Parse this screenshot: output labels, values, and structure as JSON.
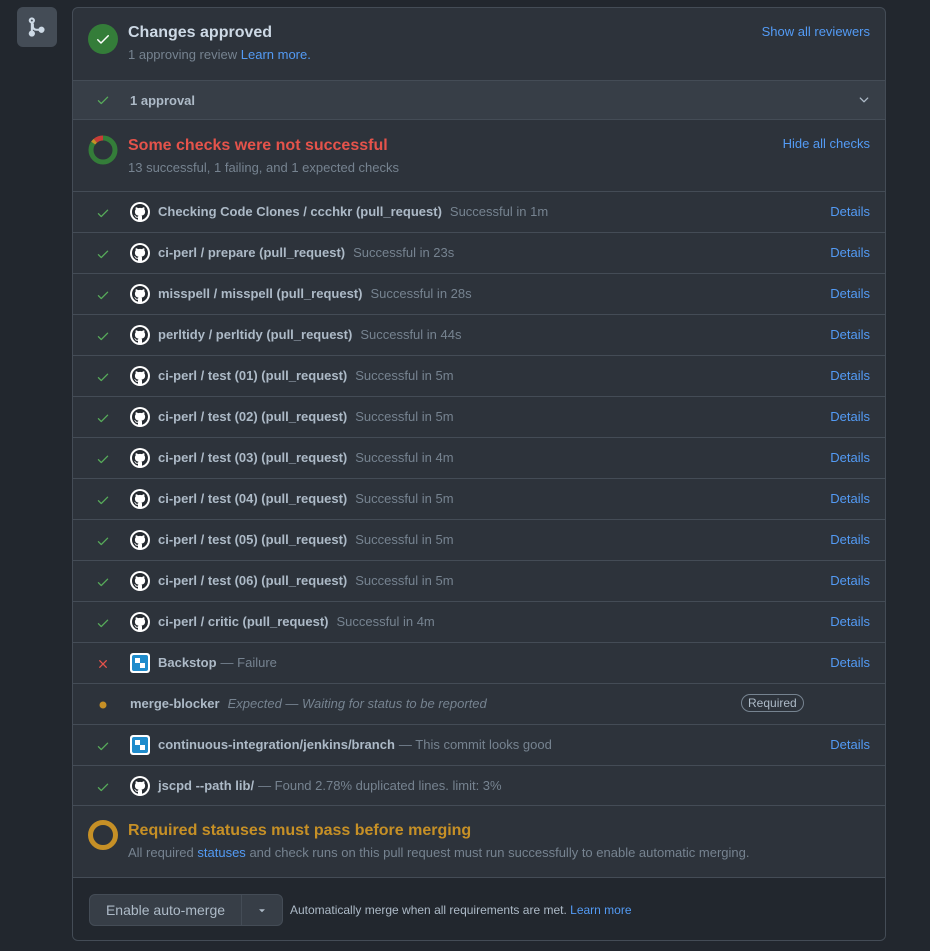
{
  "colors": {
    "green": "#57ab5a",
    "red": "#e5534b",
    "yellow": "#c69026",
    "link": "#539bf5"
  },
  "review": {
    "title": "Changes approved",
    "subtitle": "1 approving review",
    "learn_more": "Learn more.",
    "show_all": "Show all reviewers",
    "approval_row": "1 approval"
  },
  "checks_header": {
    "title": "Some checks were not successful",
    "subtitle": "13 successful, 1 failing, and 1 expected checks",
    "hide_all": "Hide all checks"
  },
  "checks": [
    {
      "status": "success",
      "avatar": "github",
      "name": "Checking Code Clones / ccchkr (pull_request)",
      "desc": "Successful in 1m",
      "details": "Details"
    },
    {
      "status": "success",
      "avatar": "github",
      "name": "ci-perl / prepare (pull_request)",
      "desc": "Successful in 23s",
      "details": "Details"
    },
    {
      "status": "success",
      "avatar": "github",
      "name": "misspell / misspell (pull_request)",
      "desc": "Successful in 28s",
      "details": "Details"
    },
    {
      "status": "success",
      "avatar": "github",
      "name": "perltidy / perltidy (pull_request)",
      "desc": "Successful in 44s",
      "details": "Details"
    },
    {
      "status": "success",
      "avatar": "github",
      "name": "ci-perl / test (01) (pull_request)",
      "desc": "Successful in 5m",
      "details": "Details"
    },
    {
      "status": "success",
      "avatar": "github",
      "name": "ci-perl / test (02) (pull_request)",
      "desc": "Successful in 5m",
      "details": "Details"
    },
    {
      "status": "success",
      "avatar": "github",
      "name": "ci-perl / test (03) (pull_request)",
      "desc": "Successful in 4m",
      "details": "Details"
    },
    {
      "status": "success",
      "avatar": "github",
      "name": "ci-perl / test (04) (pull_request)",
      "desc": "Successful in 5m",
      "details": "Details"
    },
    {
      "status": "success",
      "avatar": "github",
      "name": "ci-perl / test (05) (pull_request)",
      "desc": "Successful in 5m",
      "details": "Details"
    },
    {
      "status": "success",
      "avatar": "github",
      "name": "ci-perl / test (06) (pull_request)",
      "desc": "Successful in 5m",
      "details": "Details"
    },
    {
      "status": "success",
      "avatar": "github",
      "name": "ci-perl / critic (pull_request)",
      "desc": "Successful in 4m",
      "details": "Details"
    },
    {
      "status": "failure",
      "avatar": "jenkins",
      "name": "Backstop",
      "desc": "— Failure",
      "details": "Details"
    },
    {
      "status": "pending",
      "avatar": "none",
      "name": "merge-blocker",
      "desc": "Expected — Waiting for status to be reported",
      "badge": "Required"
    },
    {
      "status": "success",
      "avatar": "jenkins",
      "name": "continuous-integration/jenkins/branch",
      "desc": "— This commit looks good",
      "details": "Details"
    },
    {
      "status": "success",
      "avatar": "github",
      "name": "jscpd --path lib/",
      "desc": "— Found 2.78% duplicated lines. limit: 3%"
    }
  ],
  "required": {
    "title": "Required statuses must pass before merging",
    "text_before": "All required",
    "link": "statuses",
    "text_after": "and check runs on this pull request must run successfully to enable automatic merging."
  },
  "merge": {
    "button": "Enable auto-merge",
    "note": "Automatically merge when all requirements are met.",
    "learn_more": "Learn more"
  }
}
